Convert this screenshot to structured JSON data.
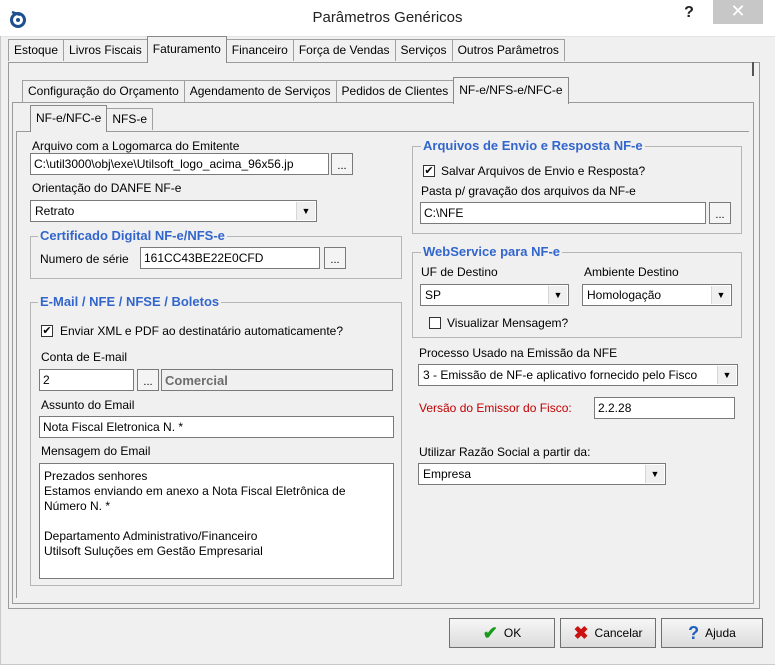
{
  "window": {
    "title": "Parâmetros Genéricos",
    "help": "?",
    "close": "✕"
  },
  "tabs_main": [
    "Estoque",
    "Livros Fiscais",
    "Faturamento",
    "Financeiro",
    "Força de Vendas",
    "Serviços",
    "Outros Parâmetros"
  ],
  "tabs_fat": [
    "Configuração do Orçamento",
    "Agendamento de Serviços",
    "Pedidos de Clientes",
    "NF-e/NFS-e/NFC-e"
  ],
  "tabs_nf": [
    "NF-e/NFC-e",
    "NFS-e"
  ],
  "emitente": {
    "logo_label": "Arquivo com a Logomarca do Emitente",
    "logo_value": "C:\\util3000\\obj\\exe\\Utilsoft_logo_acima_96x56.jp",
    "danfe_label": "Orientação do DANFE NF-e",
    "danfe_value": "Retrato"
  },
  "cert": {
    "title": "Certificado Digital NF-e/NFS-e",
    "serie_label": "Numero de série",
    "serie_value": "161CC43BE22E0CFD"
  },
  "email": {
    "title": "E-Mail / NFE / NFSE / Boletos",
    "auto_label": "Enviar XML e PDF ao destinatário automaticamente?",
    "auto_checked": "✔",
    "conta_label": "Conta de E-mail",
    "conta_value": "2",
    "conta_name": "Comercial",
    "assunto_label": "Assunto do Email",
    "assunto_value": "Nota Fiscal Eletronica N. *",
    "msg_label": "Mensagem do Email",
    "msg_lines": [
      "Prezados senhores",
      "Estamos enviando em anexo a Nota Fiscal Eletrônica de",
      "Número N. *",
      "",
      "Departamento Administrativo/Financeiro",
      "Utilsoft Suluções em Gestão Empresarial"
    ]
  },
  "arquivos": {
    "title": "Arquivos de Envio e Resposta NF-e",
    "salvar_label": "Salvar Arquivos de Envio e Resposta?",
    "salvar_checked": "✔",
    "pasta_label": "Pasta p/ gravação dos arquivos da NF-e",
    "pasta_value": "C:\\NFE"
  },
  "webservice": {
    "title": "WebService para NF-e",
    "uf_label": "UF de Destino",
    "uf_value": "SP",
    "amb_label": "Ambiente Destino",
    "amb_value": "Homologação",
    "visualizar_label": "Visualizar Mensagem?",
    "visualizar_checked": ""
  },
  "processo": {
    "label": "Processo Usado na Emissão da NFE",
    "value": "3 - Emissão de NF-e aplicativo fornecido pelo Fisco",
    "versao_label": "Versão do Emissor do Fisco:",
    "versao_value": "2.2.28",
    "razao_label": "Utilizar Razão Social a partir da:",
    "razao_value": "Empresa"
  },
  "buttons": {
    "ok": "OK",
    "cancel": "Cancelar",
    "help": "Ajuda"
  },
  "colors": {
    "group_title": "#3366cc",
    "red_label": "#c00000",
    "ok_icon": "#1a9a1a",
    "cancel_icon": "#cc1111",
    "help_icon": "#1f5fbf"
  }
}
